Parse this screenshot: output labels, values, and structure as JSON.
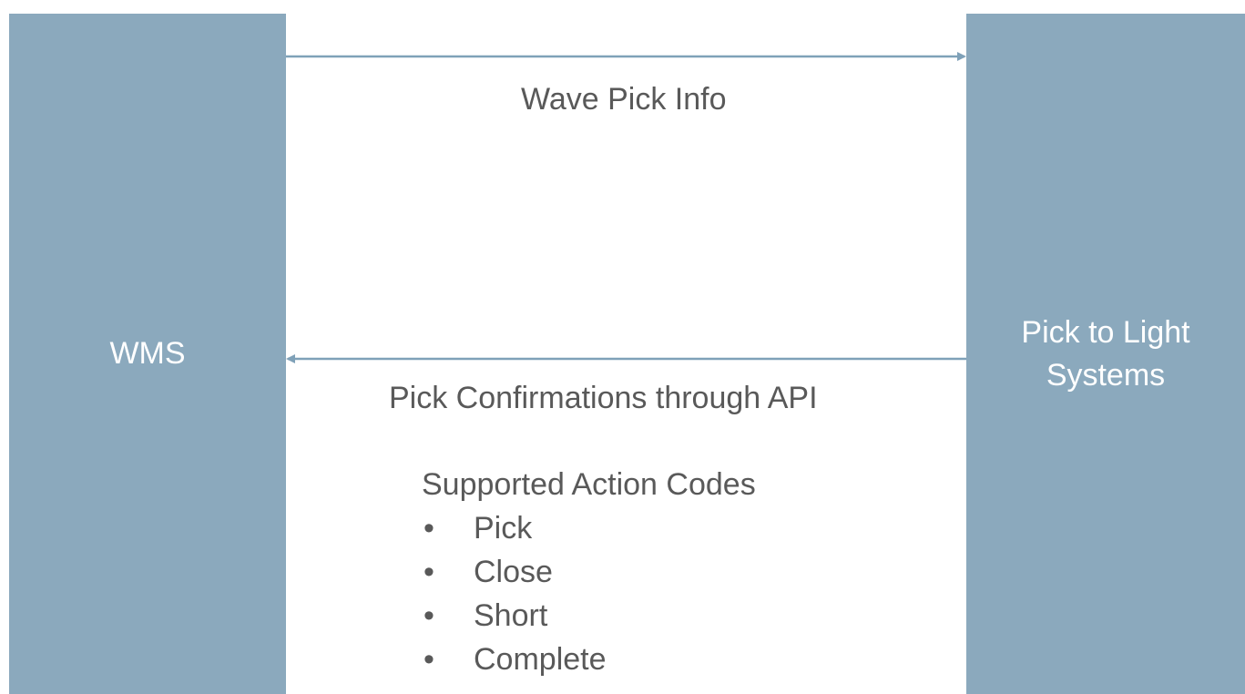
{
  "systems": {
    "left": "WMS",
    "right": "Pick to Light\nSystems"
  },
  "flows": {
    "top": "Wave Pick Info",
    "bottom": "Pick Confirmations through API"
  },
  "action_codes": {
    "title": "Supported Action Codes",
    "items": [
      "Pick",
      "Close",
      "Short",
      "Complete"
    ]
  },
  "colors": {
    "box": "#8ba9bd",
    "arrow": "#7fa1b8",
    "text": "#595959"
  }
}
